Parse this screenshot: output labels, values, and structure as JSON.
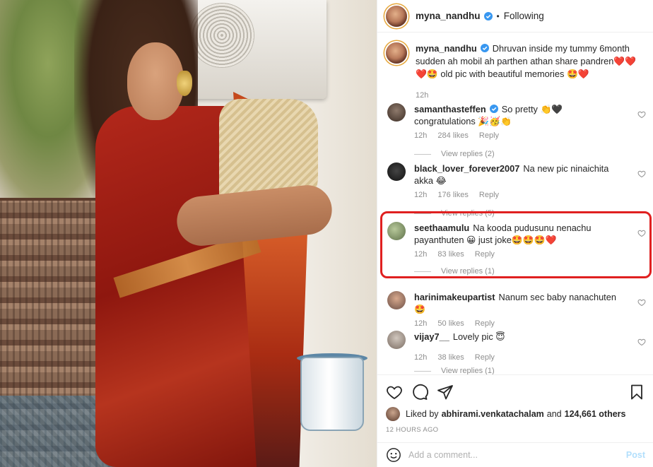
{
  "post": {
    "author": "myna_nandhu",
    "follow_status": "Following",
    "caption": "Dhruvan inside my tummy 6month sudden ah mobil ah parthen athan share pandren❤️❤️❤️🤩 old pic with beautiful memories 🤩❤️",
    "time": "12h"
  },
  "comments": [
    {
      "user": "samanthasteffen",
      "text": "So pretty 👏🖤 congratulations 🎉🥳👏",
      "time": "12h",
      "likes": "284 likes",
      "reply": "Reply",
      "view_replies": "View replies (2)"
    },
    {
      "user": "black_lover_forever2007",
      "text": "Na new pic ninaichita akka 😂",
      "time": "12h",
      "likes": "176 likes",
      "reply": "Reply",
      "view_replies": "View replies (5)"
    },
    {
      "user": "seethaamulu",
      "text": "Na kooda pudusunu nenachu payanthuten 😀 just joke🤩🤩🤩❤️",
      "time": "12h",
      "likes": "83 likes",
      "reply": "Reply",
      "view_replies": "View replies (1)"
    },
    {
      "user": "harinimakeupartist",
      "text": "Nanum sec baby nanachuten🤩",
      "time": "12h",
      "likes": "50 likes",
      "reply": "Reply"
    },
    {
      "user": "vijay7__",
      "text": "Lovely pic 😇",
      "time": "12h",
      "likes": "38 likes",
      "reply": "Reply",
      "view_replies": "View replies (1)"
    }
  ],
  "likes_bar": {
    "prefix": "Liked by",
    "user": "abhirami.venkatachalam",
    "connector": "and",
    "count": "124,661 others"
  },
  "time_ago": "12 HOURS AGO",
  "add_comment": {
    "placeholder": "Add a comment...",
    "post_label": "Post"
  },
  "colors": {
    "highlight": "#e02020",
    "verified": "#3897f0",
    "link": "#b2dffc"
  },
  "icons": [
    "verified-badge-icon",
    "heart-icon",
    "comment-icon",
    "share-icon",
    "bookmark-icon",
    "emoji-icon"
  ]
}
